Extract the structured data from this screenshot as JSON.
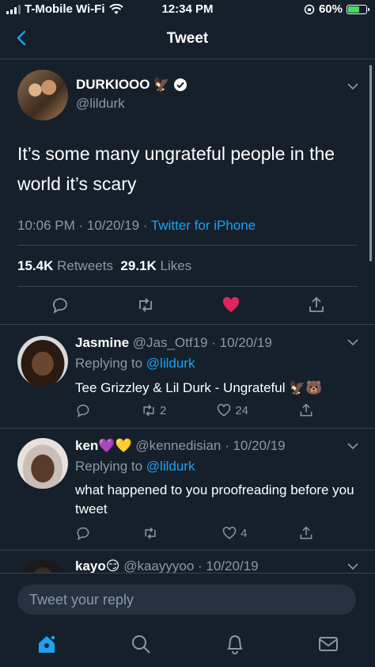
{
  "status_bar": {
    "carrier": "T-Mobile Wi-Fi",
    "time": "12:34 PM",
    "battery": "60%"
  },
  "navbar": {
    "title": "Tweet"
  },
  "main_tweet": {
    "name": "DURKIOOO",
    "name_emoji": "🦅",
    "handle": "@lildurk",
    "text": "It’s some many ungrateful people in the world it’s scary",
    "time_date": "10:06 PM · 10/20/19 · ",
    "source": "Twitter for iPhone",
    "retweets_count": "15.4K",
    "retweets_label": " Retweets",
    "likes_count": "29.1K",
    "likes_label": " Likes"
  },
  "replies": [
    {
      "name": "Jasmine",
      "handle_date": " @Jas_Otf19 · 10/20/19",
      "replying_label": "Replying to ",
      "replying_handle": "@lildurk",
      "text": "Tee Grizzley & Lil Durk - Ungrateful 🦅🐻",
      "retweets": "2",
      "likes": "24"
    },
    {
      "name": "ken",
      "name_emoji": "💜💛",
      "handle_date": " @kennedisian · 10/20/19",
      "replying_label": "Replying to ",
      "replying_handle": "@lildurk",
      "text": "what happened to you proofreading before you tweet",
      "retweets": "",
      "likes": "4"
    },
    {
      "name": "kayo",
      "name_emoji": "😏",
      "handle_date": " @kaayyyoo · 10/20/19"
    }
  ],
  "reply_bar": {
    "placeholder": "Tweet your reply"
  },
  "colors": {
    "background": "#15202b",
    "accent": "#1da1f2",
    "like": "#e0245e",
    "muted": "#8899a6",
    "border": "#38444d"
  }
}
